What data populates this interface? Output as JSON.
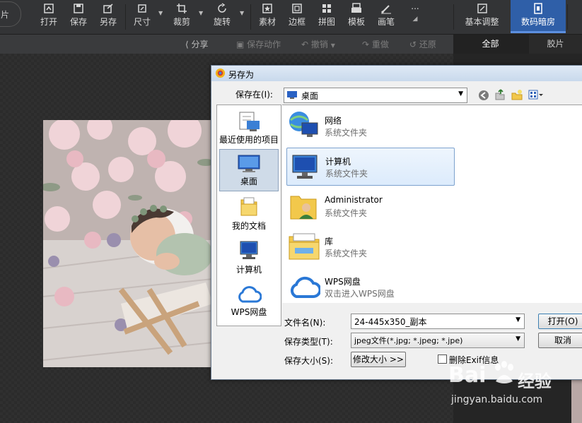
{
  "toolbar": {
    "partial_tab": "片",
    "open": "打开",
    "save": "保存",
    "save_as": "另存",
    "size": "尺寸",
    "crop": "裁剪",
    "rotate": "旋转",
    "material": "素材",
    "border": "边框",
    "collage": "拼图",
    "template": "模板",
    "brush": "画笔",
    "more": "...",
    "tab_basic": "基本调整",
    "tab_darkroom": "数码暗房"
  },
  "subbar": {
    "share": "分享",
    "save_action": "保存动作",
    "undo": "撤销",
    "redo": "重做",
    "restore": "还原"
  },
  "panel_tabs": {
    "all": "全部",
    "film": "胶片"
  },
  "dialog": {
    "title": "另存为",
    "save_in_label": "保存在(I):",
    "save_in_value": "桌面",
    "places": [
      {
        "label": "最近使用的项目"
      },
      {
        "label": "桌面"
      },
      {
        "label": "我的文档"
      },
      {
        "label": "计算机"
      },
      {
        "label": "WPS网盘"
      }
    ],
    "items": [
      {
        "name": "网络",
        "desc": "系统文件夹"
      },
      {
        "name": "计算机",
        "desc": "系统文件夹"
      },
      {
        "name": "Administrator",
        "desc": "系统文件夹"
      },
      {
        "name": "库",
        "desc": "系统文件夹"
      },
      {
        "name": "WPS网盘",
        "desc": "双击进入WPS网盘"
      }
    ],
    "filename_label": "文件名(N):",
    "filename_value": "24-445x350_副本",
    "filetype_label": "保存类型(T):",
    "filetype_value": "jpeg文件(*.jpg; *.jpeg; *.jpe)",
    "filesize_label": "保存大小(S):",
    "resize_button": "修改大小 >>",
    "exif_label": "删除Exif信息",
    "open_button": "打开(O)",
    "cancel_button": "取消"
  },
  "watermark": {
    "brand": "Bai",
    "brand_cn": "经验",
    "url": "jingyan.baidu.com"
  },
  "colors": {
    "accent_tab": "#2f5fa8",
    "toolbar_bg": "#333436",
    "dialog_bg": "#f0f0f0",
    "selection": "#dcebfc"
  }
}
